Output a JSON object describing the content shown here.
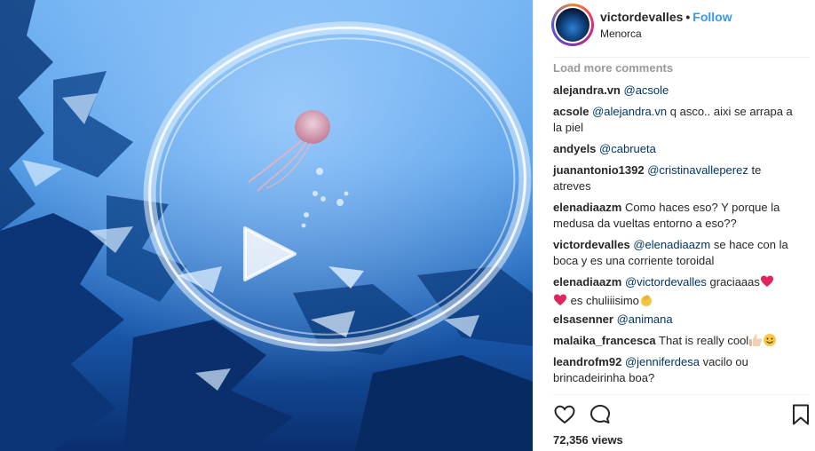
{
  "post": {
    "username": "victordevalles",
    "separator": "•",
    "follow_label": "Follow",
    "location": "Menorca"
  },
  "load_more_label": "Load more comments",
  "comments": [
    {
      "user": "alejandra.vn",
      "mention": "@acsole",
      "text": ""
    },
    {
      "user": "acsole",
      "mention": "@alejandra.vn",
      "text": " q asco.. aixi se arrapa a la piel"
    },
    {
      "user": "andyels",
      "mention": "@cabrueta",
      "text": ""
    },
    {
      "user": "juanantonio1392",
      "mention": "@cristinavalleperez",
      "text": " te atreves"
    },
    {
      "user": "elenadiaazm",
      "mention": "",
      "text": "Como haces eso? Y porque la medusa da vueltas entorno a eso??"
    },
    {
      "user": "victordevalles",
      "mention": "@elenadiaazm",
      "text": " se hace con la boca y es una corriente toroidal"
    },
    {
      "user": "elenadiaazm",
      "mention": "@victordevalles",
      "text": " graciaaas",
      "text2": " es chuliiisimo"
    },
    {
      "user": "elsasenner",
      "mention": "@animana",
      "text": ""
    },
    {
      "user": "malaika_francesca",
      "mention": "",
      "text": "That is really cool"
    },
    {
      "user": "leandrofm92",
      "mention": "@jenniferdesa",
      "text": " vacilo ou brincadeirinha boa?"
    }
  ],
  "views": "72,356 views",
  "icons": {
    "play": "play-icon",
    "like": "heart-icon",
    "comment": "comment-icon",
    "save": "bookmark-icon"
  },
  "colors": {
    "follow": "#3897f0",
    "muted": "#999999",
    "mention": "#003569"
  }
}
